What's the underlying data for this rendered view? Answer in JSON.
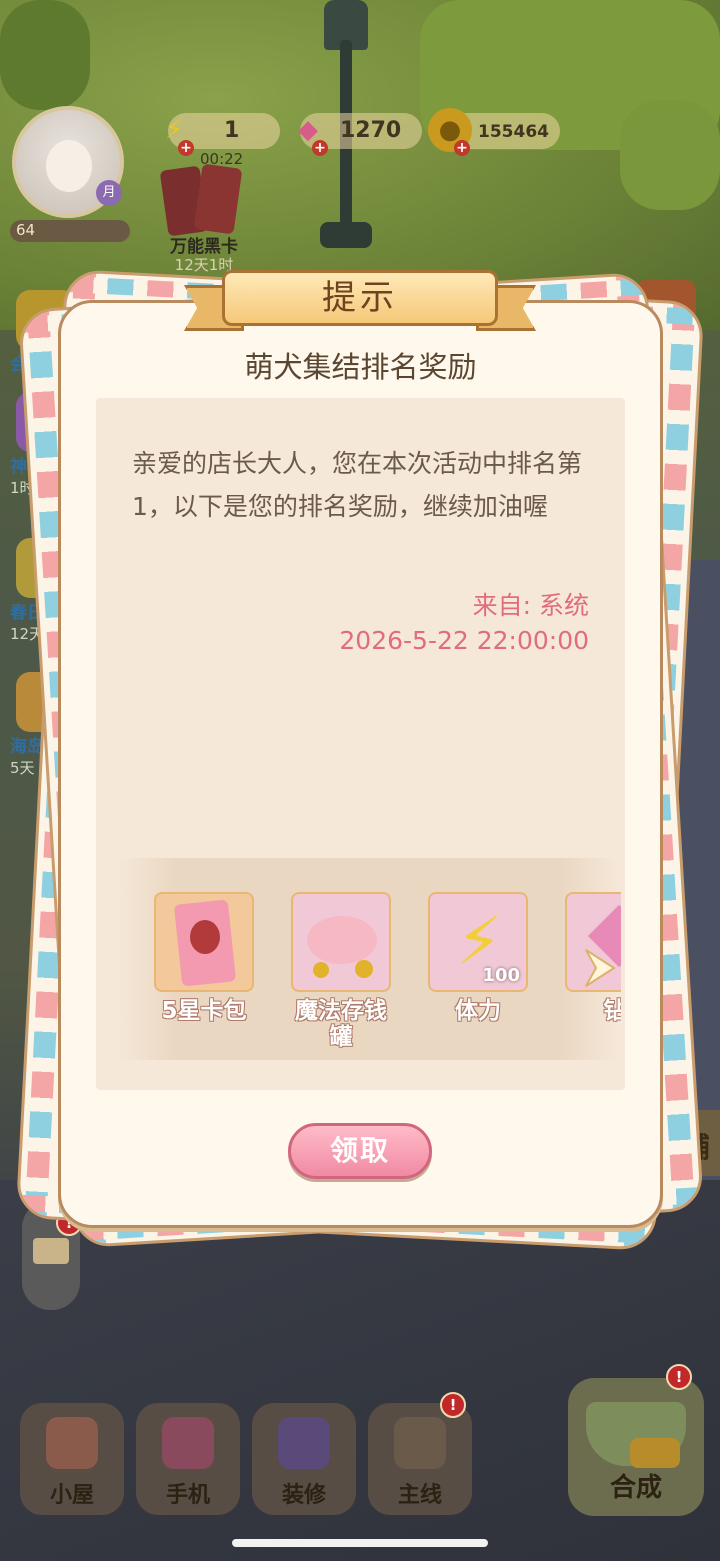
{
  "hud": {
    "stamina": "1",
    "stamina_timer": "00:22",
    "gems": "1270",
    "coins": "155464",
    "player_level": "64",
    "avatar_badge": "月",
    "card_event_title": "万能黑卡",
    "card_event_timer": "12天1时"
  },
  "side_events": [
    {
      "label": "会",
      "sub": ""
    },
    {
      "label": "神秘",
      "sub": "1时"
    },
    {
      "label": "春日",
      "sub": "12天"
    },
    {
      "label": "海岛",
      "sub": "5天"
    }
  ],
  "shop_label": "店铺",
  "dialog": {
    "title": "提示",
    "subtitle": "萌犬集结排名奖励",
    "message": "亲爱的店长大人，您在本次活动中排名第1，以下是您的排名奖励，继续加油喔",
    "from": "来自: 系统",
    "date": "2026-5-22 22:00:00",
    "claim_button": "领取",
    "rewards": [
      {
        "label": "5星卡包",
        "qty": "",
        "icon": "card-pack-icon"
      },
      {
        "label": "魔法存钱罐",
        "qty": "",
        "icon": "piggy-bank-icon"
      },
      {
        "label": "体力",
        "qty": "100",
        "icon": "lightning-icon"
      },
      {
        "label": "钻",
        "qty": "",
        "icon": "gem-icon"
      }
    ]
  },
  "nav": {
    "house": "小屋",
    "phone": "手机",
    "decorate": "装修",
    "main_story": "主线",
    "merge": "合成"
  },
  "notify_mark": "!",
  "colors": {
    "dialog_bg": "#fff8ec",
    "content_bg": "#f6e8d9",
    "accent_pink": "#e06e7a",
    "ribbon_gold": "#f5c878"
  }
}
